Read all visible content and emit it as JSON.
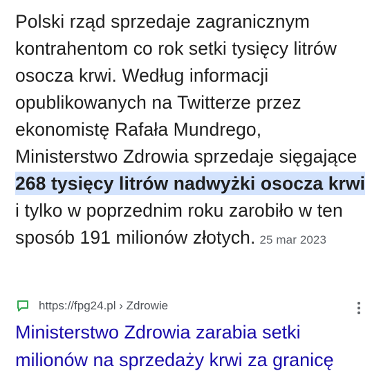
{
  "snippet": {
    "text_before": "Polski rząd sprzedaje zagranicznym kontrahentom co rok setki tysięcy litrów osocza krwi. Według informacji opublikowanych na Twitterze przez ekonomistę Rafała Mundrego, Ministerstwo Zdrowia sprzedaje sięgające ",
    "highlight": "268 tysięcy litrów nadwyżki osocza krwi",
    "text_after": " i tylko w poprzednim roku zarobiło w ten sposób 191 milionów złotych.",
    "date": "25 mar 2023"
  },
  "result": {
    "source_icon": "chat-bubble-icon",
    "url": "https://fpg24.pl › Zdrowie",
    "title": "Ministerstwo Zdrowia zarabia setki milionów na sprzedaży krwi za granicę",
    "more_icon": "more-vert-icon"
  },
  "colors": {
    "highlight_bg": "#d3e3fd",
    "link": "#1a0dab",
    "icon_green": "#34a853",
    "muted": "#5f6368"
  }
}
